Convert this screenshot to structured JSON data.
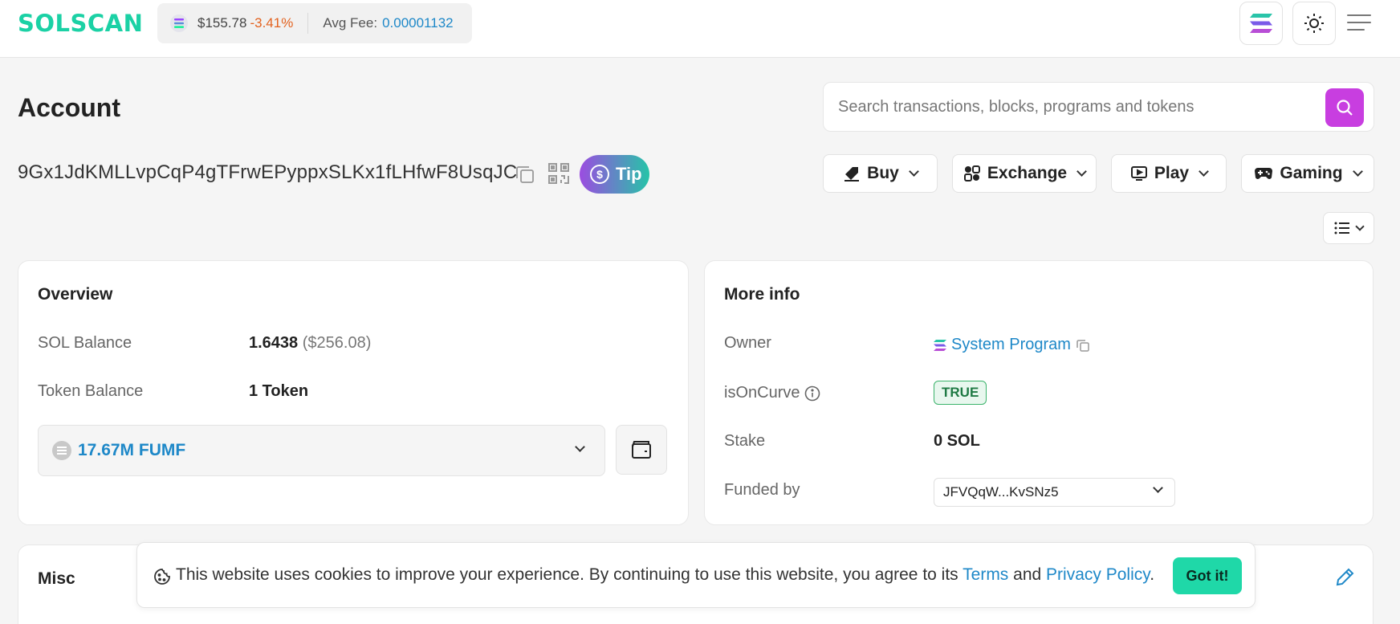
{
  "header": {
    "logo": "SOLSCAN",
    "sol_price": "$155.78",
    "sol_change": "-3.41%",
    "avg_fee_label": "Avg Fee:",
    "avg_fee_value": "0.00001132"
  },
  "page": {
    "title": "Account",
    "address": "9Gx1JdKMLLvpCqP4gTFrwEPyppxSLKx1fLHfwF8UsqJC",
    "tip_label": "Tip"
  },
  "search": {
    "placeholder": "Search transactions, blocks, programs and tokens"
  },
  "actions": [
    {
      "label": "Buy"
    },
    {
      "label": "Exchange"
    },
    {
      "label": "Play"
    },
    {
      "label": "Gaming"
    }
  ],
  "overview": {
    "title": "Overview",
    "sol_balance_label": "SOL Balance",
    "sol_balance_value": "1.6438",
    "sol_balance_usd": "($256.08)",
    "token_balance_label": "Token Balance",
    "token_balance_value": "1 Token",
    "token_selected": "17.67M FUMF"
  },
  "more_info": {
    "title": "More info",
    "owner_label": "Owner",
    "owner_value": "System Program",
    "is_on_curve_label": "isOnCurve",
    "is_on_curve_value": "TRUE",
    "stake_label": "Stake",
    "stake_value": "0 SOL",
    "funded_by_label": "Funded by",
    "funded_by_value": "JFVQqW...KvSNz5"
  },
  "misc": {
    "title": "Misc"
  },
  "cookie": {
    "text_before": "This website uses cookies to improve your experience. By continuing to use this website, you agree to its",
    "terms": "Terms",
    "and": "and",
    "privacy": "Privacy Policy",
    "period": ".",
    "button": "Got it!"
  },
  "colors": {
    "brand": "#1bd1a5",
    "accent": "#c83ee0",
    "link": "#1e88c8",
    "negative": "#e3621f"
  }
}
